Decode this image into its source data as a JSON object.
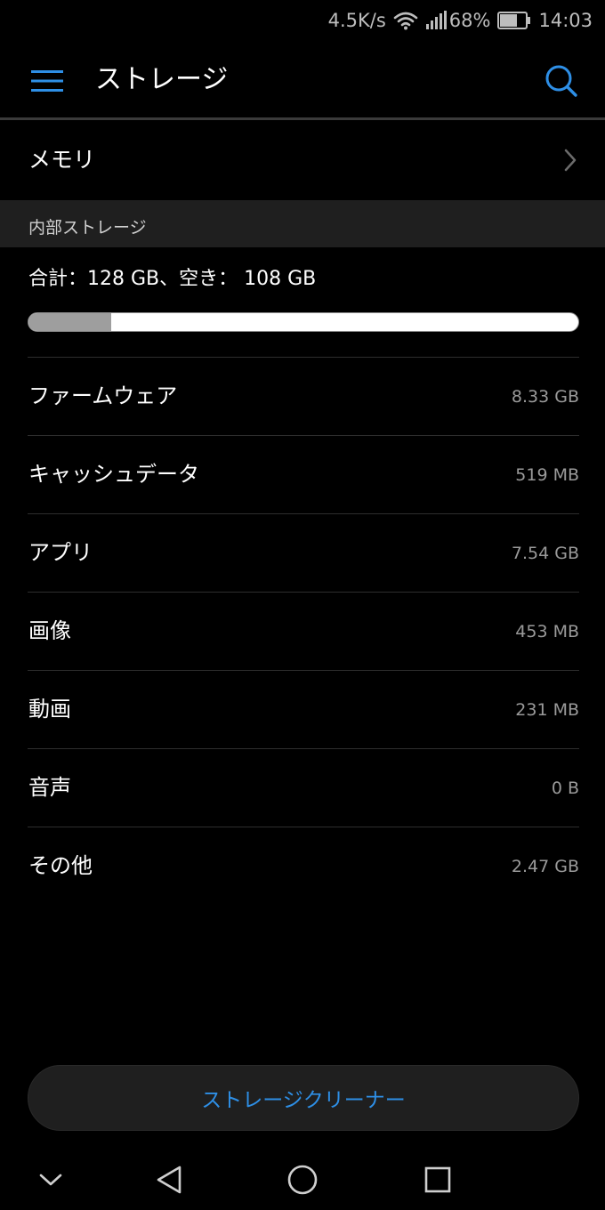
{
  "status_bar": {
    "net_speed": "4.5K/s",
    "battery_percent": "68%",
    "battery_level": 0.68,
    "time": "14:03",
    "icons": [
      "wifi-icon",
      "signal-icon",
      "battery-icon"
    ]
  },
  "toolbar": {
    "title": "ストレージ",
    "menu_icon": "hamburger-menu-icon",
    "search_icon": "search-icon"
  },
  "memory": {
    "label": "メモリ",
    "icon": "chevron-right-icon"
  },
  "internal_storage": {
    "header": "内部ストレージ",
    "summary": "合計：128 GB、空き： 108 GB",
    "used_fraction": 0.15
  },
  "items": [
    {
      "label": "ファームウェア",
      "value": "8.33 GB"
    },
    {
      "label": "キャッシュデータ",
      "value": "519 MB"
    },
    {
      "label": "アプリ",
      "value": "7.54 GB"
    },
    {
      "label": "画像",
      "value": "453 MB"
    },
    {
      "label": "動画",
      "value": "231 MB"
    },
    {
      "label": "音声",
      "value": "0 B"
    },
    {
      "label": "その他",
      "value": "2.47 GB"
    }
  ],
  "cleaner_button": {
    "label": "ストレージクリーナー"
  },
  "nav_bar": {
    "icons": [
      "nav-collapse-icon",
      "nav-back-icon",
      "nav-home-icon",
      "nav-recents-icon"
    ]
  },
  "colors": {
    "accent": "#2e8fe6",
    "background": "#000000",
    "secondary_text": "#9a9a9a"
  }
}
